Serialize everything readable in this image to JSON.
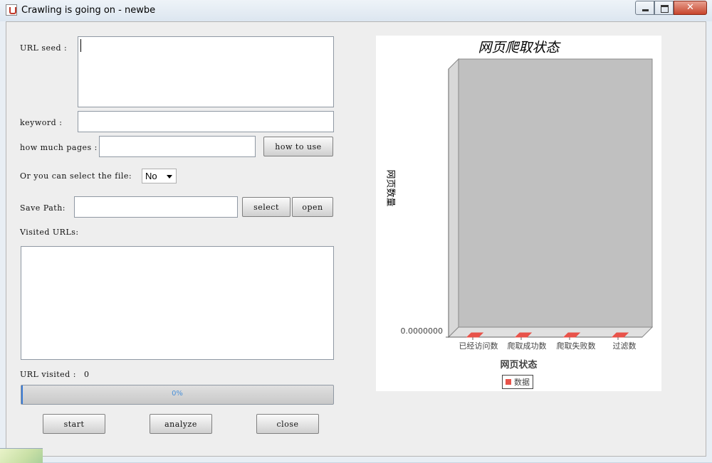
{
  "window": {
    "title": "Crawling is going on - newbe",
    "close_glyph": "✕"
  },
  "form": {
    "url_seed_label": "URL seed :",
    "url_seed_value": "",
    "keyword_label": "keyword :",
    "keyword_value": "",
    "pages_label": "how much pages :",
    "pages_value": "",
    "how_to_use_label": "how to use",
    "select_file_label": "Or you can select the file:",
    "select_file_value": "No",
    "save_path_label": "Save Path:",
    "save_path_value": "",
    "select_label": "select",
    "open_label": "open",
    "visited_urls_label": "Visited URLs:",
    "visited_urls_value": "",
    "url_visited_label": "URL visited :",
    "url_visited_count": "0",
    "progress_text": "0%",
    "progress_value": 0.005,
    "start_label": "start",
    "analyze_label": "analyze",
    "close_label": "close"
  },
  "chart_data": {
    "type": "bar",
    "title": "网页爬取状态",
    "xlabel": "网页状态",
    "ylabel": "网页数量",
    "categories": [
      "已经访问数",
      "爬取成功数",
      "爬取失败数",
      "过滤数"
    ],
    "series": [
      {
        "name": "数据",
        "values": [
          0,
          0,
          0,
          0
        ]
      }
    ],
    "ylim": [
      0,
      1
    ],
    "y_tick_labels": [
      "0.0000000"
    ],
    "legend_position": "bottom",
    "grid": false,
    "colors": {
      "series": "#e8534a",
      "plot_background": "#c0c0c0"
    }
  }
}
